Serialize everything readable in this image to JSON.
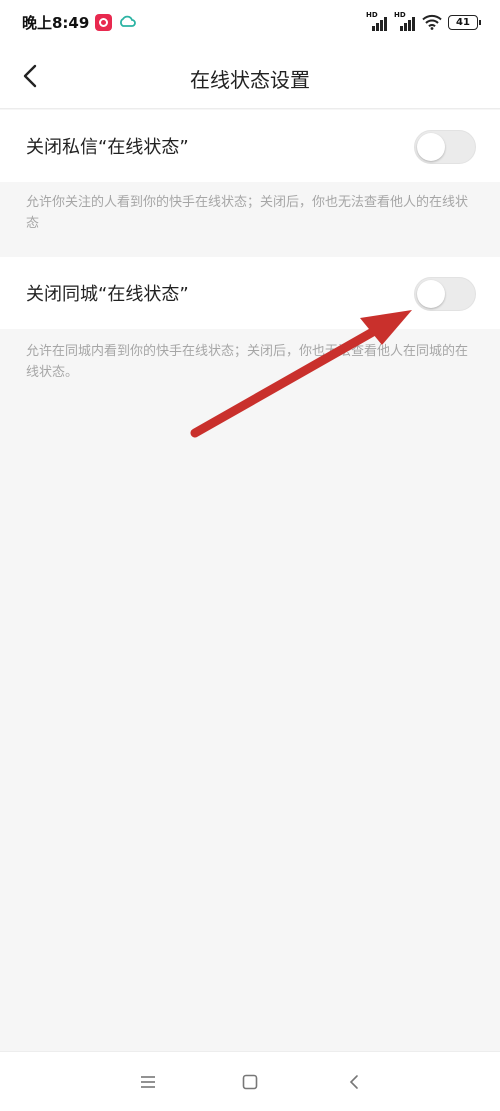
{
  "status_bar": {
    "time": "晚上8:49",
    "app_icon": "kuaishou-app-icon",
    "cloud_icon": "cloud-icon",
    "signal_label_1": "HD",
    "signal_label_2": "HD",
    "wifi_icon": "wifi-icon",
    "battery_level": "41"
  },
  "nav": {
    "back_icon": "back-chevron-icon",
    "title": "在线状态设置"
  },
  "settings": [
    {
      "label": "关闭私信“在线状态”",
      "toggle_on": false,
      "description": "允许你关注的人看到你的快手在线状态；关闭后，你也无法查看他人的在线状态"
    },
    {
      "label": "关闭同城“在线状态”",
      "toggle_on": false,
      "description": "允许在同城内看到你的快手在线状态；关闭后，你也无法查看他人在同城的在线状态。"
    }
  ],
  "annotation": {
    "arrow_color": "#c9302c",
    "points_to": "setting-2-toggle"
  },
  "system_nav": {
    "menu_icon": "menu-icon",
    "home_icon": "home-icon",
    "back_icon": "back-icon"
  },
  "colors": {
    "background": "#f6f6f6",
    "row_background": "#ffffff",
    "description_text": "#a6a6a6",
    "toggle_off": "#ebebeb"
  }
}
